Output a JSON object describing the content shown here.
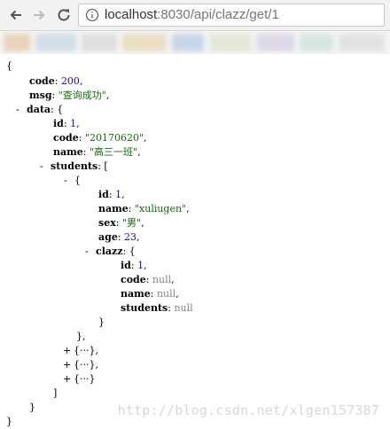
{
  "browser": {
    "url_host": "localhost",
    "url_rest": ":8030/api/clazz/get/1"
  },
  "json_view": {
    "lines": [
      {
        "p": [
          {
            "t": "{",
            "c": ""
          }
        ]
      },
      {
        "p": [
          {
            "t": "code",
            "c": "key"
          },
          {
            "t": ": ",
            "c": ""
          },
          {
            "t": "200",
            "c": "num"
          },
          {
            "t": ",",
            "c": ""
          }
        ]
      },
      {
        "p": [
          {
            "t": "msg",
            "c": "key"
          },
          {
            "t": ": ",
            "c": ""
          },
          {
            "t": "\"查询成功\"",
            "c": "str"
          },
          {
            "t": ",",
            "c": ""
          }
        ]
      },
      {
        "p": [
          {
            "t": "-",
            "c": "tog"
          },
          {
            "t": "data",
            "c": "key"
          },
          {
            "t": ": {",
            "c": ""
          }
        ]
      },
      {
        "p": [
          {
            "t": "id",
            "c": "key"
          },
          {
            "t": ": ",
            "c": ""
          },
          {
            "t": "1",
            "c": "num"
          },
          {
            "t": ",",
            "c": ""
          }
        ]
      },
      {
        "p": [
          {
            "t": "code",
            "c": "key"
          },
          {
            "t": ": ",
            "c": ""
          },
          {
            "t": "\"20170620\"",
            "c": "str"
          },
          {
            "t": ",",
            "c": ""
          }
        ]
      },
      {
        "p": [
          {
            "t": "name",
            "c": "key"
          },
          {
            "t": ": ",
            "c": ""
          },
          {
            "t": "\"高三一班\"",
            "c": "str"
          },
          {
            "t": ",",
            "c": ""
          }
        ]
      },
      {
        "p": [
          {
            "t": "-",
            "c": "tog"
          },
          {
            "t": "students",
            "c": "key"
          },
          {
            "t": ": [",
            "c": ""
          }
        ]
      },
      {
        "p": [
          {
            "t": "-",
            "c": "tog"
          },
          {
            "t": "{",
            "c": ""
          }
        ]
      },
      {
        "p": [
          {
            "t": "id",
            "c": "key"
          },
          {
            "t": ": ",
            "c": ""
          },
          {
            "t": "1",
            "c": "num"
          },
          {
            "t": ",",
            "c": ""
          }
        ]
      },
      {
        "p": [
          {
            "t": "name",
            "c": "key"
          },
          {
            "t": ": ",
            "c": ""
          },
          {
            "t": "\"xuliugen\"",
            "c": "str"
          },
          {
            "t": ",",
            "c": ""
          }
        ]
      },
      {
        "p": [
          {
            "t": "sex",
            "c": "key"
          },
          {
            "t": ": ",
            "c": ""
          },
          {
            "t": "\"男\"",
            "c": "str"
          },
          {
            "t": ",",
            "c": ""
          }
        ]
      },
      {
        "p": [
          {
            "t": "age",
            "c": "key"
          },
          {
            "t": ": ",
            "c": ""
          },
          {
            "t": "23",
            "c": "num"
          },
          {
            "t": ",",
            "c": ""
          }
        ]
      },
      {
        "p": [
          {
            "t": "-",
            "c": "tog"
          },
          {
            "t": "clazz",
            "c": "key"
          },
          {
            "t": ": {",
            "c": ""
          }
        ]
      },
      {
        "p": [
          {
            "t": "id",
            "c": "key"
          },
          {
            "t": ": ",
            "c": ""
          },
          {
            "t": "1",
            "c": "num"
          },
          {
            "t": ",",
            "c": ""
          }
        ]
      },
      {
        "p": [
          {
            "t": "code",
            "c": "key"
          },
          {
            "t": ": ",
            "c": ""
          },
          {
            "t": "null",
            "c": "nul"
          },
          {
            "t": ",",
            "c": ""
          }
        ]
      },
      {
        "p": [
          {
            "t": "name",
            "c": "key"
          },
          {
            "t": ": ",
            "c": ""
          },
          {
            "t": "null",
            "c": "nul"
          },
          {
            "t": ",",
            "c": ""
          }
        ]
      },
      {
        "p": [
          {
            "t": "students",
            "c": "key"
          },
          {
            "t": ": ",
            "c": ""
          },
          {
            "t": "null",
            "c": "nul"
          }
        ]
      },
      {
        "p": [
          {
            "t": "}",
            "c": ""
          }
        ]
      },
      {
        "p": [
          {
            "t": "},",
            "c": ""
          }
        ]
      },
      {
        "p": [
          {
            "t": "+",
            "c": "tog"
          },
          {
            "t": "{···},",
            "c": ""
          }
        ]
      },
      {
        "p": [
          {
            "t": "+",
            "c": "tog"
          },
          {
            "t": "{···},",
            "c": ""
          }
        ]
      },
      {
        "p": [
          {
            "t": "+",
            "c": "tog"
          },
          {
            "t": "{···}",
            "c": ""
          }
        ]
      },
      {
        "p": [
          {
            "t": "]",
            "c": ""
          }
        ]
      },
      {
        "p": [
          {
            "t": "}",
            "c": ""
          }
        ]
      },
      {
        "p": [
          {
            "t": "}",
            "c": ""
          }
        ]
      }
    ]
  },
  "watermark": "http://blog.csdn.net/xlgen157387"
}
